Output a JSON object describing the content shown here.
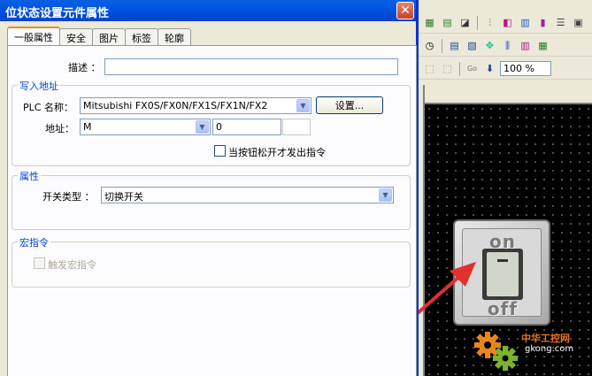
{
  "dialog": {
    "title": "位状态设置元件属性",
    "close_label": "✕",
    "tabs": [
      {
        "label": "一般属性",
        "active": true
      },
      {
        "label": "安全"
      },
      {
        "label": "图片"
      },
      {
        "label": "标签"
      },
      {
        "label": "轮廓"
      }
    ],
    "description_label": "描述 ：",
    "description_value": "",
    "write_group": {
      "title": "写入地址",
      "plc_label": "PLC 名称：",
      "plc_value": "Mitsubishi FX0S/FX0N/FX1S/FX1N/FX2",
      "settings_button": "设置...",
      "address_label": "地址：",
      "address_type": "M",
      "address_value": "0",
      "release_checkbox_label": "当按钮松开才发出指令"
    },
    "attr_group": {
      "title": "属性",
      "switch_type_label": "开关类型 ：",
      "switch_type_value": "切换开关"
    },
    "macro_group": {
      "title": "宏指令",
      "trigger_checkbox_label": "触发宏指令"
    }
  },
  "background_app": {
    "zoom_level": "100 %",
    "switch_on_text": "on",
    "switch_off_text": "off"
  },
  "watermark": {
    "cn_text": "中华工控网",
    "url_text": "gkong.com"
  },
  "colors": {
    "titlebar": "#0054e3",
    "group_title": "#0046d5",
    "arrow": "#e03030",
    "canvas": "#000000"
  }
}
